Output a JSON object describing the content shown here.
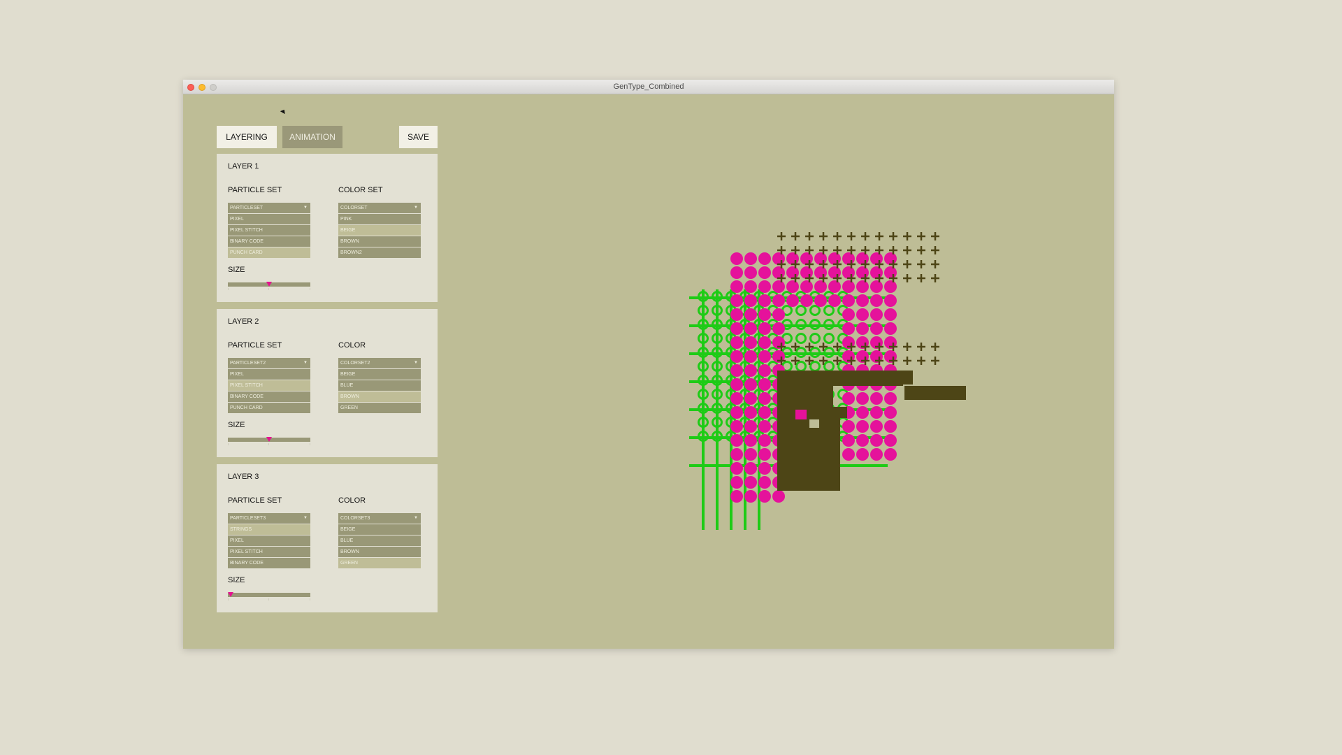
{
  "window": {
    "title": "GenType_Combined"
  },
  "tabs": {
    "layering": "LAYERING",
    "animation": "ANIMATION",
    "save": "SAVE"
  },
  "layers": [
    {
      "title": "LAYER 1",
      "particle_label": "PARTICLE SET",
      "color_label": "COLOR SET",
      "particle_options": [
        {
          "text": "PARTICLESET",
          "highlight": false
        },
        {
          "text": "PIXEL",
          "highlight": false
        },
        {
          "text": "PIXEL STITCH",
          "highlight": false
        },
        {
          "text": "BINARY CODE",
          "highlight": false
        },
        {
          "text": "PUNCH CARD",
          "highlight": true
        }
      ],
      "color_options": [
        {
          "text": "COLORSET",
          "highlight": false
        },
        {
          "text": "PINK",
          "highlight": false
        },
        {
          "text": "BEIGE",
          "highlight": true
        },
        {
          "text": "BROWN",
          "highlight": false
        },
        {
          "text": "BROWN2",
          "highlight": false
        }
      ],
      "size_label": "SIZE",
      "size_value": 0.5
    },
    {
      "title": "LAYER 2",
      "particle_label": "PARTICLE SET",
      "color_label": "COLOR",
      "particle_options": [
        {
          "text": "PARTICLESET2",
          "highlight": false
        },
        {
          "text": "PIXEL",
          "highlight": false
        },
        {
          "text": "PIXEL STITCH",
          "highlight": true
        },
        {
          "text": "BINARY CODE",
          "highlight": false
        },
        {
          "text": "PUNCH CARD",
          "highlight": false
        }
      ],
      "color_options": [
        {
          "text": "COLORSET2",
          "highlight": false
        },
        {
          "text": "BEIGE",
          "highlight": false
        },
        {
          "text": "BLUE",
          "highlight": false
        },
        {
          "text": "BROWN",
          "highlight": true
        },
        {
          "text": "GREEN",
          "highlight": false
        }
      ],
      "size_label": "SIZE",
      "size_value": 0.5
    },
    {
      "title": "LAYER 3",
      "particle_label": "PARTICLE SET",
      "color_label": "COLOR",
      "particle_options": [
        {
          "text": "PARTICLESET3",
          "highlight": false
        },
        {
          "text": "STRINGS",
          "highlight": true
        },
        {
          "text": "PIXEL",
          "highlight": false
        },
        {
          "text": "PIXEL STITCH",
          "highlight": false
        },
        {
          "text": "BINARY CODE",
          "highlight": false
        }
      ],
      "color_options": [
        {
          "text": "COLORSET3",
          "highlight": false
        },
        {
          "text": "BEIGE",
          "highlight": false
        },
        {
          "text": "BLUE",
          "highlight": false
        },
        {
          "text": "BROWN",
          "highlight": false
        },
        {
          "text": "GREEN",
          "highlight": true
        }
      ],
      "size_label": "SIZE",
      "size_value": 0.03
    }
  ],
  "colors": {
    "pink": "#e5129b",
    "green": "#1ecb16",
    "brown": "#4d4516",
    "background": "#bebd96",
    "panel": "#e3e1d4",
    "dropdown": "#999877",
    "dropdown_highlight": "#bfbd97"
  }
}
